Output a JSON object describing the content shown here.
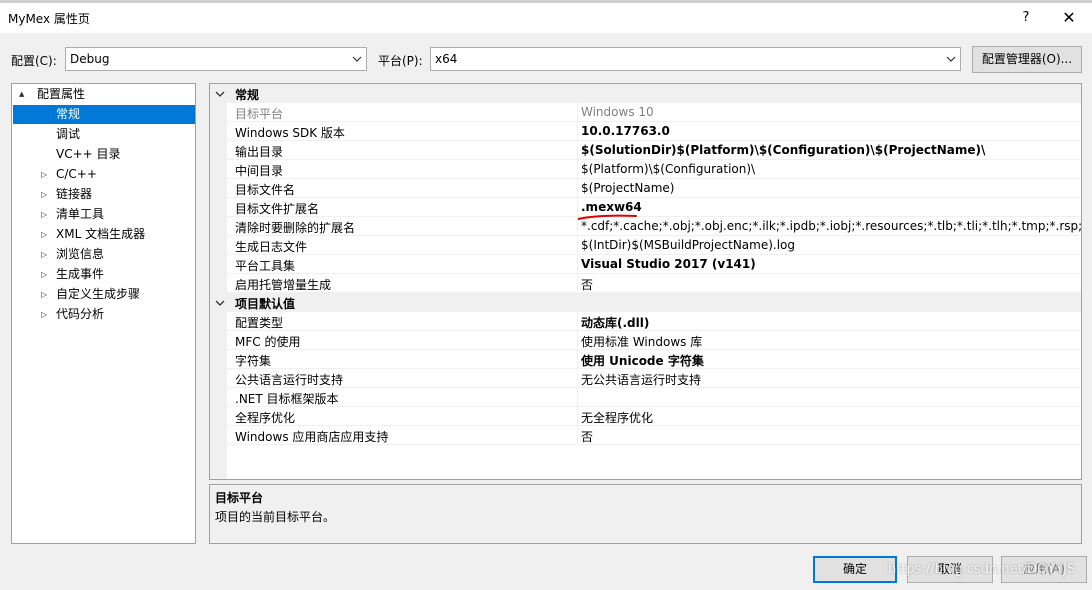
{
  "window": {
    "title": "MyMex 属性页",
    "help": "?",
    "close": "✕"
  },
  "config": {
    "config_label": "配置(C):",
    "config_value": "Debug",
    "platform_label": "平台(P):",
    "platform_value": "x64",
    "manager_button": "配置管理器(O)..."
  },
  "tree": {
    "items": [
      {
        "label": "配置属性",
        "expander": "▲"
      },
      {
        "label": "常规",
        "expander": ""
      },
      {
        "label": "调试",
        "expander": ""
      },
      {
        "label": "VC++ 目录",
        "expander": ""
      },
      {
        "label": "C/C++",
        "expander": "▷"
      },
      {
        "label": "链接器",
        "expander": "▷"
      },
      {
        "label": "清单工具",
        "expander": "▷"
      },
      {
        "label": "XML 文档生成器",
        "expander": "▷"
      },
      {
        "label": "浏览信息",
        "expander": "▷"
      },
      {
        "label": "生成事件",
        "expander": "▷"
      },
      {
        "label": "自定义生成步骤",
        "expander": "▷"
      },
      {
        "label": "代码分析",
        "expander": "▷"
      }
    ]
  },
  "grid": {
    "cat_general": "常规",
    "cat_defaults": "项目默认值",
    "general_rows": [
      {
        "name": "目标平台",
        "value": "Windows 10"
      },
      {
        "name": "Windows SDK 版本",
        "value": "10.0.17763.0"
      },
      {
        "name": "输出目录",
        "value": "$(SolutionDir)$(Platform)\\$(Configuration)\\$(ProjectName)\\"
      },
      {
        "name": "中间目录",
        "value": "$(Platform)\\$(Configuration)\\"
      },
      {
        "name": "目标文件名",
        "value": "$(ProjectName)"
      },
      {
        "name": "目标文件扩展名",
        "value": ".mexw64"
      },
      {
        "name": "清除时要删除的扩展名",
        "value": "*.cdf;*.cache;*.obj;*.obj.enc;*.ilk;*.ipdb;*.iobj;*.resources;*.tlb;*.tli;*.tlh;*.tmp;*.rsp;*.pgc;*.p"
      },
      {
        "name": "生成日志文件",
        "value": "$(IntDir)$(MSBuildProjectName).log"
      },
      {
        "name": "平台工具集",
        "value": "Visual Studio 2017 (v141)"
      },
      {
        "name": "启用托管增量生成",
        "value": "否"
      }
    ],
    "default_rows": [
      {
        "name": "配置类型",
        "value": "动态库(.dll)"
      },
      {
        "name": "MFC 的使用",
        "value": "使用标准 Windows 库"
      },
      {
        "name": "字符集",
        "value": "使用 Unicode 字符集"
      },
      {
        "name": "公共语言运行时支持",
        "value": "无公共语言运行时支持"
      },
      {
        "name": ".NET 目标框架版本",
        "value": ""
      },
      {
        "name": "全程序优化",
        "value": "无全程序优化"
      },
      {
        "name": "Windows 应用商店应用支持",
        "value": "否"
      }
    ]
  },
  "description": {
    "title": "目标平台",
    "text": "项目的当前目标平台。"
  },
  "buttons": {
    "ok": "确定",
    "cancel": "取消",
    "apply": "应用(A)"
  },
  "watermark": "https://blog.csdn.net/DQYYJS",
  "colors": {
    "selection": "#0078d7",
    "annotation": "#e00000"
  }
}
